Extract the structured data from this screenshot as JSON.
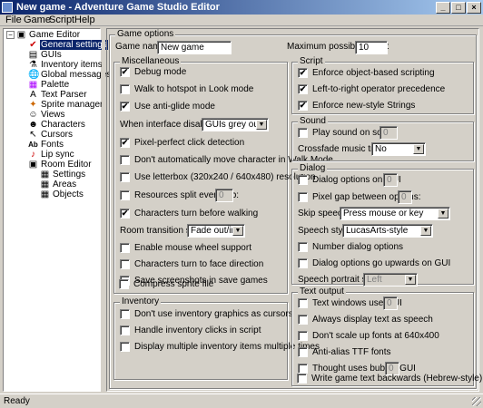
{
  "window": {
    "title": "New game - Adventure Game Studio Editor",
    "min": "_",
    "max": "□",
    "close": "×"
  },
  "menu": [
    "File",
    "Game",
    "Script",
    "Help"
  ],
  "tree": [
    {
      "label": "Game Editor",
      "icon": "▣",
      "ico_name": "game-editor-icon"
    },
    {
      "label": "General settings",
      "icon": "✔",
      "ico_name": "checkmark-icon"
    },
    {
      "label": "GUIs",
      "icon": "▤",
      "ico_name": "gui-icon"
    },
    {
      "label": "Inventory items",
      "icon": "⚗",
      "ico_name": "inventory-icon"
    },
    {
      "label": "Global messages",
      "icon": "🌐",
      "ico_name": "globe-icon"
    },
    {
      "label": "Palette",
      "icon": "▦",
      "ico_name": "palette-icon"
    },
    {
      "label": "Text Parser",
      "icon": "A",
      "ico_name": "text-parser-icon"
    },
    {
      "label": "Sprite manager",
      "icon": "✦",
      "ico_name": "sprite-icon"
    },
    {
      "label": "Views",
      "icon": "☺",
      "ico_name": "views-icon"
    },
    {
      "label": "Characters",
      "icon": "☻",
      "ico_name": "characters-icon"
    },
    {
      "label": "Cursors",
      "icon": "↖",
      "ico_name": "cursor-icon"
    },
    {
      "label": "Fonts",
      "icon": "Ab",
      "ico_name": "fonts-icon"
    },
    {
      "label": "Lip sync",
      "icon": "♪",
      "ico_name": "lip-sync-icon"
    },
    {
      "label": "Room Editor",
      "icon": "▣",
      "ico_name": "room-editor-icon"
    },
    {
      "label": "Settings",
      "icon": "▦",
      "ico_name": "settings-icon"
    },
    {
      "label": "Areas",
      "icon": "▦",
      "ico_name": "areas-icon"
    },
    {
      "label": "Objects",
      "icon": "▦",
      "ico_name": "objects-icon"
    }
  ],
  "tree_expander": "−",
  "groups": {
    "options": "Game options",
    "misc": "Miscellaneous",
    "inventory": "Inventory",
    "script": "Script",
    "sound": "Sound",
    "dialog": "Dialog",
    "text": "Text output"
  },
  "game_name": {
    "label": "Game name:",
    "value": "New game"
  },
  "max_score": {
    "label": "Maximum possible score:",
    "value": "10"
  },
  "check": "✔",
  "misc": [
    {
      "label": "Debug mode",
      "checked": true
    },
    {
      "label": "Walk to hotspot in Look mode",
      "checked": false
    },
    {
      "label": "Use anti-glide mode",
      "checked": true
    },
    {
      "label": "Pixel-perfect click detection",
      "checked": true
    },
    {
      "label": "Don't automatically move character in Walk Mode",
      "checked": false
    },
    {
      "label": "Use letterbox (320x240 / 640x480) resolution",
      "checked": false
    },
    {
      "label": "Resources split every Mb:",
      "checked": false
    },
    {
      "label": "Characters turn before walking",
      "checked": true
    },
    {
      "label": "Enable mouse wheel support",
      "checked": false
    },
    {
      "label": "Characters turn to face direction",
      "checked": false
    },
    {
      "label": "Save screenshots in save games",
      "checked": false
    },
    {
      "label": "Compress sprite file",
      "checked": false
    }
  ],
  "interface_disabled": {
    "label": "When interface disabled:",
    "value": "GUIs grey out"
  },
  "split_value": "0",
  "room_transition": {
    "label": "Room transition style:",
    "value": "Fade out/in"
  },
  "inventory": [
    {
      "label": "Don't use inventory graphics as cursors",
      "checked": false
    },
    {
      "label": "Handle inventory clicks in script",
      "checked": false
    },
    {
      "label": "Display multiple inventory items multiple times",
      "checked": false
    }
  ],
  "script": [
    {
      "label": "Enforce object-based scripting",
      "checked": true
    },
    {
      "label": "Left-to-right operator precedence",
      "checked": true
    },
    {
      "label": "Enforce new-style Strings",
      "checked": true
    }
  ],
  "sound": {
    "play": {
      "label": "Play sound on score",
      "checked": false,
      "value": "0"
    },
    "crossfade": {
      "label": "Crossfade music tracks:",
      "value": "No"
    }
  },
  "dialog": {
    "on_gui": {
      "label": "Dialog options on GUI",
      "checked": false,
      "value": "0"
    },
    "gap": {
      "label": "Pixel gap between options:",
      "checked": false,
      "value": "0"
    },
    "skip": {
      "label": "Skip speech:",
      "value": "Press mouse or key"
    },
    "style": {
      "label": "Speech style:",
      "value": "LucasArts-style"
    },
    "number": {
      "label": "Number dialog options",
      "checked": false
    },
    "upwards": {
      "label": "Dialog options go upwards on GUI",
      "checked": false
    },
    "portrait": {
      "label": "Speech portrait side:",
      "value": "Left"
    }
  },
  "text": [
    {
      "label": "Text windows use GUI",
      "checked": false,
      "value": "0"
    },
    {
      "label": "Always display text as speech",
      "checked": false
    },
    {
      "label": "Don't scale up fonts at 640x400",
      "checked": false
    },
    {
      "label": "Anti-alias TTF fonts",
      "checked": false
    },
    {
      "label": "Thought uses bubble GUI",
      "checked": false,
      "value": "0"
    },
    {
      "label": "Write game text backwards (Hebrew-style)",
      "checked": false
    }
  ],
  "status": "Ready",
  "arrow": "▼"
}
